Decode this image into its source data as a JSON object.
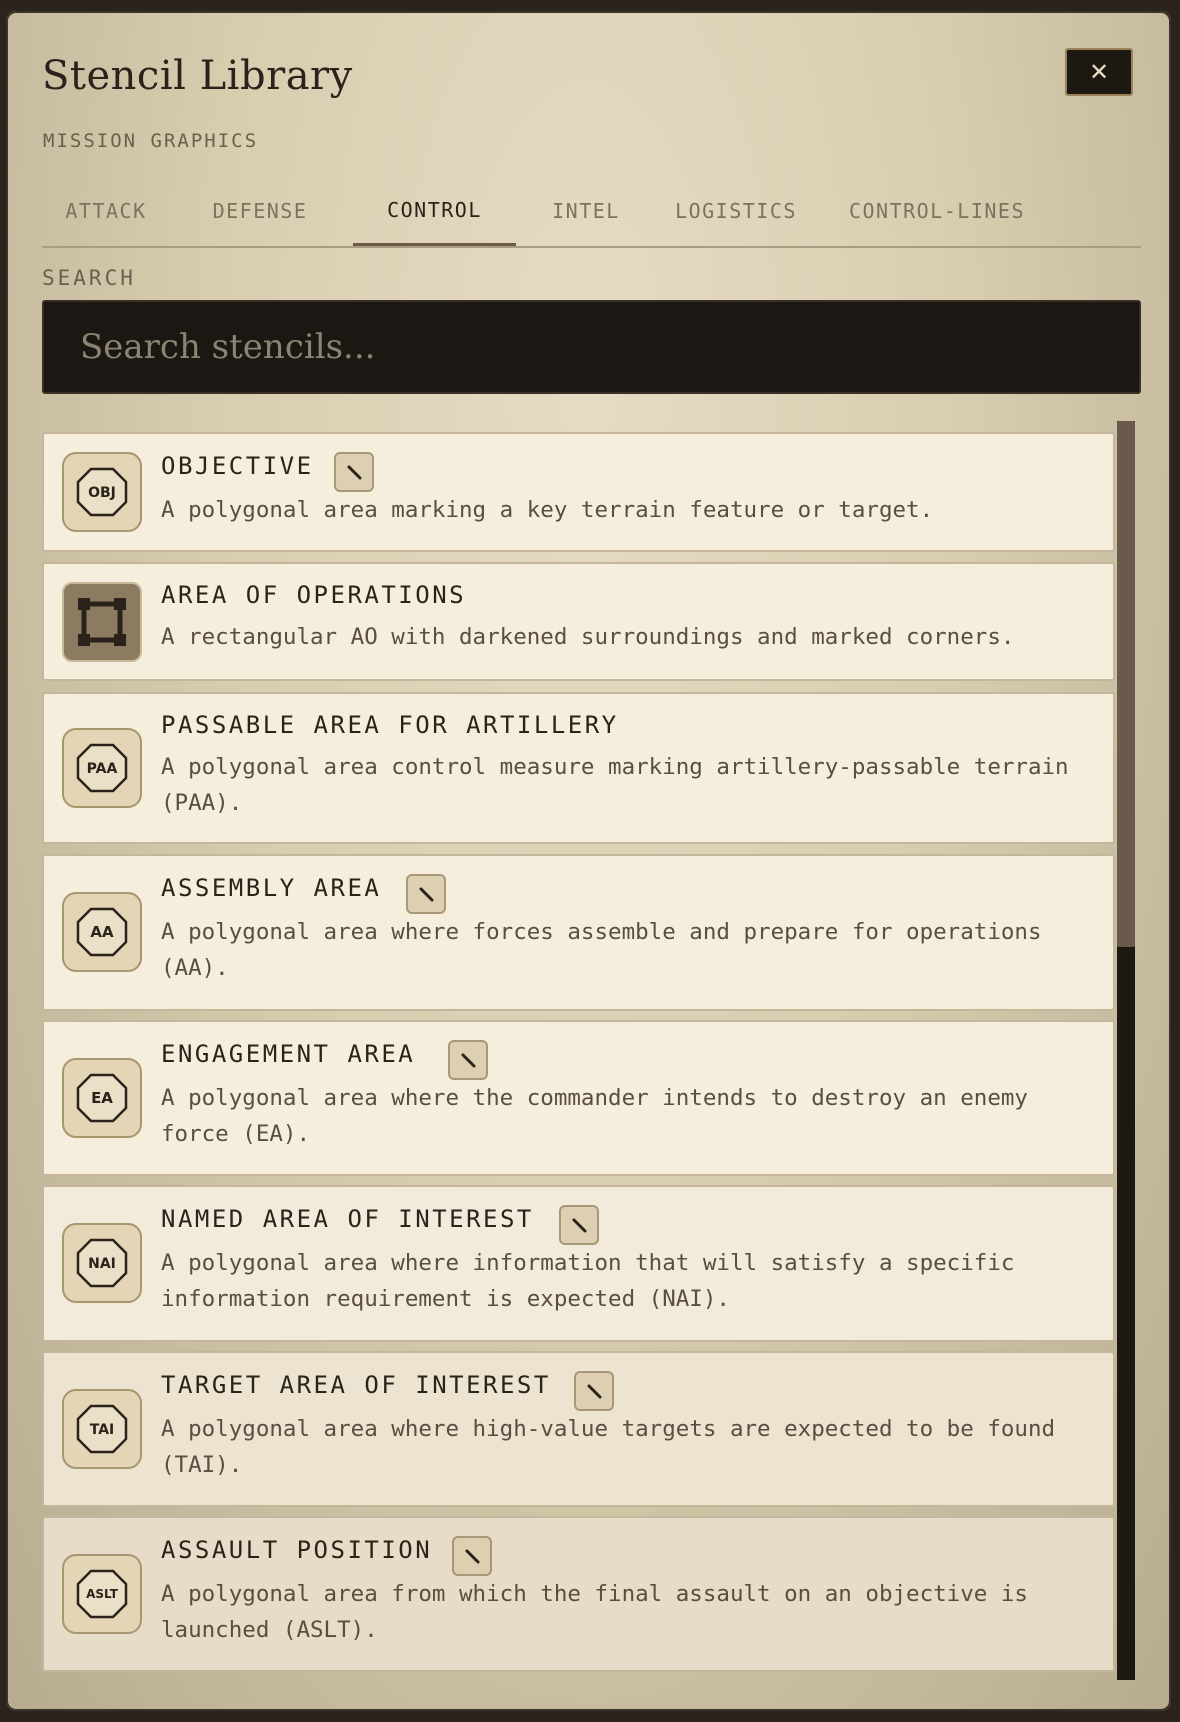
{
  "dialog": {
    "title": "Stencil Library",
    "subtitle": "MISSION GRAPHICS",
    "close_label": "✕"
  },
  "tabs": [
    {
      "label": "ATTACK",
      "active": false
    },
    {
      "label": "DEFENSE",
      "active": false
    },
    {
      "label": "CONTROL",
      "active": true
    },
    {
      "label": "INTEL",
      "active": false
    },
    {
      "label": "LOGISTICS",
      "active": false
    },
    {
      "label": "CONTROL-LINES",
      "active": false
    }
  ],
  "search": {
    "label": "SEARCH",
    "placeholder": "Search stencils...",
    "value": ""
  },
  "stencils": [
    {
      "name": "OBJECTIVE",
      "icon_text": "OBJ",
      "icon": "octagon-icon",
      "editable": true,
      "description": "A polygonal area marking a key terrain feature or target."
    },
    {
      "name": "AREA OF OPERATIONS",
      "icon_text": "",
      "icon": "rectangle-corners-icon",
      "editable": false,
      "description": "A rectangular AO with darkened surroundings and marked corners."
    },
    {
      "name": "PASSABLE AREA FOR ARTILLERY",
      "icon_text": "PAA",
      "icon": "octagon-icon",
      "editable": false,
      "description": "A polygonal area control measure marking artillery-passable terrain (PAA)."
    },
    {
      "name": "ASSEMBLY AREA",
      "icon_text": "AA",
      "icon": "octagon-icon",
      "editable": true,
      "description": "A polygonal area where forces assemble and prepare for operations (AA)."
    },
    {
      "name": "ENGAGEMENT AREA",
      "icon_text": "EA",
      "icon": "octagon-icon",
      "editable": true,
      "description": "A polygonal area where the commander intends to destroy an enemy force (EA)."
    },
    {
      "name": "NAMED AREA OF INTEREST",
      "icon_text": "NAI",
      "icon": "octagon-icon",
      "editable": true,
      "description": "A polygonal area where information that will satisfy a specific information requirement is expected (NAI)."
    },
    {
      "name": "TARGET AREA OF INTEREST",
      "icon_text": "TAI",
      "icon": "octagon-icon",
      "editable": true,
      "description": "A polygonal area where high-value targets are expected to be found (TAI)."
    },
    {
      "name": "ASSAULT POSITION",
      "icon_text": "ASLT",
      "icon": "octagon-icon",
      "editable": true,
      "description": "A polygonal area from which the final assault on an objective is launched (ASLT)."
    }
  ],
  "colors": {
    "panel": "#d9cdb0",
    "card": "#f6eedd",
    "ink": "#2b231b",
    "input_bg": "#1b1712",
    "accent_border": "#9a8259"
  }
}
